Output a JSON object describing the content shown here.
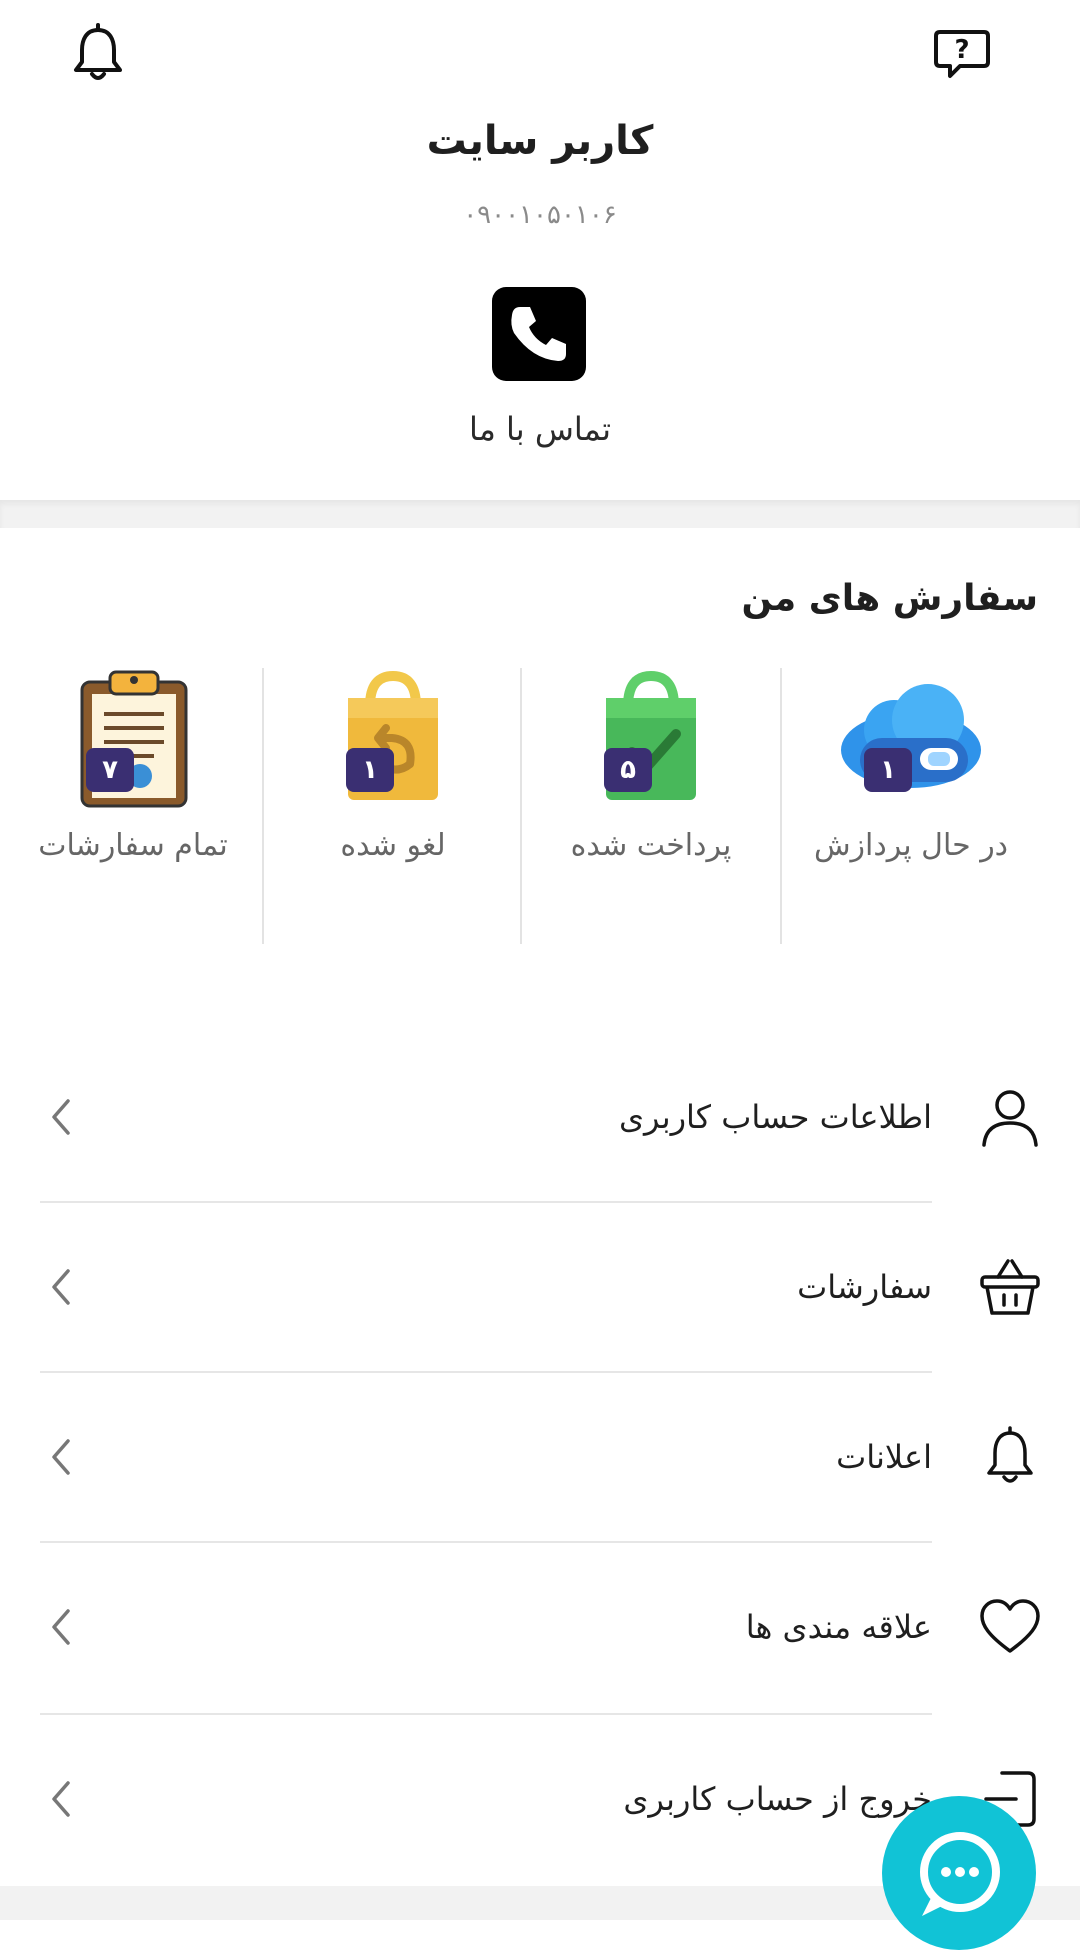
{
  "header": {
    "notifications_icon": "bell-icon",
    "help_icon": "help-chat-icon"
  },
  "profile": {
    "name": "کاربر سایت",
    "phone": "۰۹۰۰۱۰۵۰۱۰۶"
  },
  "contact": {
    "label": "تماس با ما",
    "icon": "phone-icon"
  },
  "orders": {
    "title": "سفارش های من",
    "items": [
      {
        "label": "در حال پردازش",
        "count": "۱",
        "icon": "cloud-processing-icon"
      },
      {
        "label": "پرداخت شده",
        "count": "۵",
        "icon": "paid-bag-icon"
      },
      {
        "label": "لغو شده",
        "count": "۱",
        "icon": "canceled-bag-icon"
      },
      {
        "label": "تمام سفارشات",
        "count": "۷",
        "icon": "clipboard-icon"
      }
    ]
  },
  "menu": {
    "items": [
      {
        "label": "اطلاعات حساب کاربری",
        "icon": "user-icon"
      },
      {
        "label": "سفارشات",
        "icon": "basket-icon"
      },
      {
        "label": "اعلانات",
        "icon": "bell-icon"
      },
      {
        "label": "علاقه مندی ها",
        "icon": "heart-icon"
      },
      {
        "label": "خروج از حساب کاربری",
        "icon": "logout-icon"
      }
    ]
  },
  "chat": {
    "icon": "chat-bubble-icon"
  },
  "colors": {
    "badge": "#3a2f72",
    "chat_fab": "#11c3d6",
    "divider": "#e6e6e6"
  }
}
